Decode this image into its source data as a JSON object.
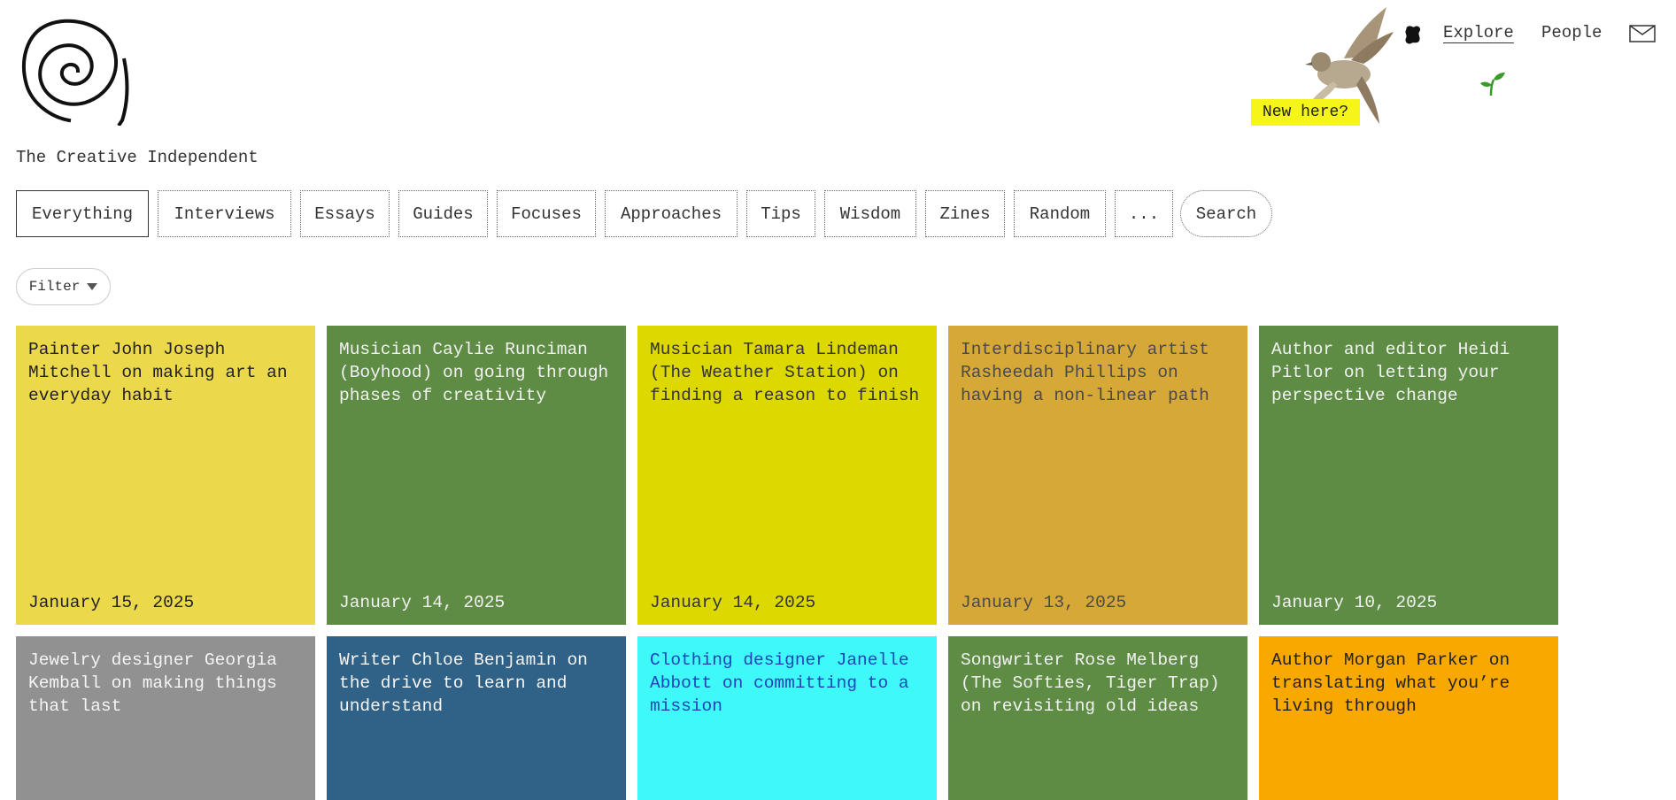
{
  "site": {
    "name": "The Creative Independent"
  },
  "header": {
    "new_here": "New here?",
    "links": [
      {
        "label": "Explore"
      },
      {
        "label": "People"
      }
    ]
  },
  "tabs": [
    {
      "label": "Everything",
      "active": true
    },
    {
      "label": "Interviews"
    },
    {
      "label": "Essays"
    },
    {
      "label": "Guides"
    },
    {
      "label": "Focuses"
    },
    {
      "label": "Approaches"
    },
    {
      "label": "Tips"
    },
    {
      "label": "Wisdom"
    },
    {
      "label": "Zines"
    },
    {
      "label": "Random"
    },
    {
      "label": "..."
    },
    {
      "label": "Search"
    }
  ],
  "filter": {
    "label": "Filter"
  },
  "cards": [
    {
      "title": "Painter John Joseph Mitchell on making art an everyday habit",
      "date": "January 15, 2025",
      "bg": "#ecd84b",
      "fg": "#222222"
    },
    {
      "title": "Musician Caylie Runciman (Boyhood) on going through phases of creativity",
      "date": "January 14, 2025",
      "bg": "#5e8c44",
      "fg": "#f2f2f2"
    },
    {
      "title": "Musician Tamara Lindeman (The Weather Station) on finding a reason to finish",
      "date": "January 14, 2025",
      "bg": "#dcd800",
      "fg": "#333333"
    },
    {
      "title": "Interdisciplinary artist Rasheedah Phillips on having a non-linear path",
      "date": "January 13, 2025",
      "bg": "#d6a838",
      "fg": "#4a4a4a"
    },
    {
      "title": "Author and editor Heidi Pitlor on letting your perspective change",
      "date": "January 10, 2025",
      "bg": "#5e8c44",
      "fg": "#f2f2f2"
    },
    {
      "title": "Jewelry designer Georgia Kemball on making things that last",
      "date": "",
      "bg": "#919191",
      "fg": "#f5f5f5"
    },
    {
      "title": "Writer Chloe Benjamin on the drive to learn and understand",
      "date": "",
      "bg": "#306187",
      "fg": "#f5f5f5"
    },
    {
      "title": "Clothing designer Janelle Abbott on committing to a mission",
      "date": "",
      "bg": "#3ff9f9",
      "fg": "#1f44b8"
    },
    {
      "title": "Songwriter Rose Melberg (The Softies, Tiger Trap) on revisiting old ideas",
      "date": "",
      "bg": "#5e8c44",
      "fg": "#f2f2f2"
    },
    {
      "title": "Author Morgan Parker on translating what you’re living through",
      "date": "",
      "bg": "#f9a800",
      "fg": "#222222"
    }
  ]
}
